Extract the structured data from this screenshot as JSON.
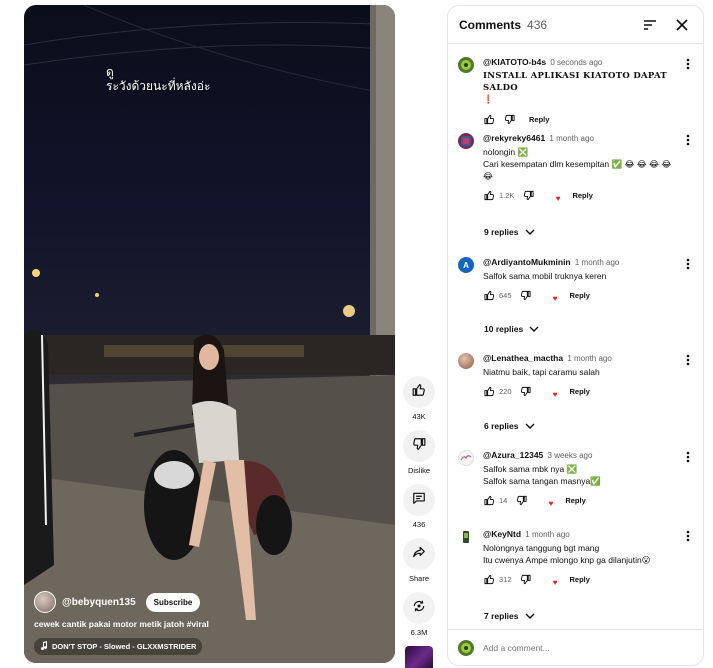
{
  "video": {
    "caption_line1": "ดู",
    "caption_line2": "ระวังด้วยนะที่หลังอ่ะ",
    "channel_handle": "@bebyquen135",
    "subscribe_label": "Subscribe",
    "title": "cewek cantik pakai motor metik jatoh ",
    "title_hashtag": "#viral",
    "sound": "DON'T STOP - Slowed - GLXXMSTRIDER"
  },
  "actions": {
    "like_count": "43K",
    "dislike_label": "Dislike",
    "comment_count": "436",
    "share_label": "Share",
    "remix_count": "6.3M"
  },
  "comments_panel": {
    "title": "Comments",
    "count": "436",
    "add_comment_placeholder": "Add a comment...",
    "reply_label": "Reply",
    "comments": [
      {
        "author": "@KIATOTO-b4s",
        "time": "0 seconds ago",
        "text_line1": "INSTALL APLIKASI KIATOTO DAPAT SALDO",
        "text_line2": "❗",
        "likes": "",
        "replies": "",
        "avatar_color": "#5a8a2a"
      },
      {
        "author": "@rekyreky6461",
        "time": "1 month ago",
        "text_line1": "nolongin ❎",
        "text_line2": "Cari kesempatan dlm kesempitan ✅ 😂 😂 😂 😂 😂",
        "likes": "1.2K",
        "replies": "9 replies",
        "avatar_color": "#7a2a4a"
      },
      {
        "author": "@ArdiyantoMukminin",
        "time": "1 month ago",
        "text_line1": "Salfok sama mobil truknya keren",
        "text_line2": "",
        "likes": "645",
        "replies": "10 replies",
        "avatar_color": "#1565c0",
        "avatar_letter": "A"
      },
      {
        "author": "@Lenathea_mactha",
        "time": "1 month ago",
        "text_line1": "Niatmu baik, tapi caramu salah",
        "text_line2": "",
        "likes": "220",
        "replies": "6 replies",
        "avatar_color": "#b08068"
      },
      {
        "author": "@Azura_12345",
        "time": "3 weeks ago",
        "text_line1": "Salfok sama mbk nya ❎",
        "text_line2": "Salfok sama tangan masnya✅",
        "likes": "14",
        "replies": "",
        "avatar_color": "#e8e8e8"
      },
      {
        "author": "@KeyNtd",
        "time": "1 month ago",
        "text_line1": "Nolongnya tanggung bgt mang",
        "text_line2": "Itu cwenya Ampe mlongo knp ga dilanjutin😮",
        "likes": "312",
        "replies": "7 replies",
        "avatar_color": "#2e4a2a"
      }
    ]
  },
  "colors": {
    "text_primary": "#0f0f0f",
    "text_secondary": "#606060",
    "border": "#e5e5e5",
    "heart": "#e62117"
  }
}
